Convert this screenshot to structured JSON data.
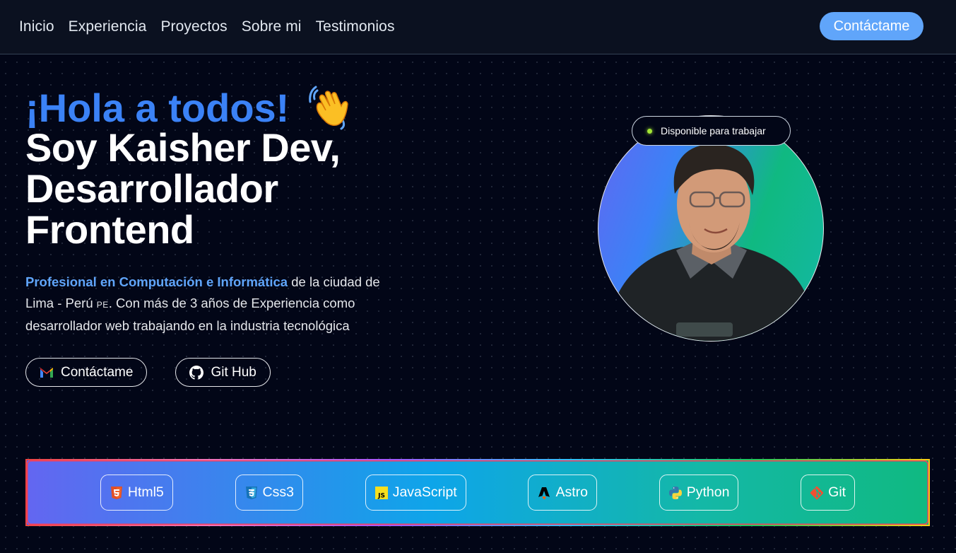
{
  "nav": {
    "links": [
      "Inicio",
      "Experiencia",
      "Proyectos",
      "Sobre mi",
      "Testimonios"
    ],
    "cta_label": "Contáctame"
  },
  "hero": {
    "greeting": "¡Hola a todos!",
    "headline_line1": "Soy Kaisher Dev,",
    "headline_line2": "Desarrollador",
    "headline_line3": "Frontend",
    "bio_highlight": "Profesional en Computación e Informática",
    "bio_part1": " de la ciudad de Lima - Perú ",
    "bio_flag": "PE",
    "bio_part2": ". Con más de 3 años de Experiencia como desarrollador web trabajando en la industria tecnológica",
    "contact_button": "Contáctame",
    "github_button": "Git Hub"
  },
  "avatar": {
    "status_text": "Disponible para trabajar",
    "status_color": "#a3e635"
  },
  "skills": [
    {
      "label": "Html5",
      "icon": "html5-icon",
      "color": "#e34f26"
    },
    {
      "label": "Css3",
      "icon": "css3-icon",
      "color": "#1572b6"
    },
    {
      "label": "JavaScript",
      "icon": "javascript-icon",
      "color": "#f7df1e"
    },
    {
      "label": "Astro",
      "icon": "astro-icon",
      "color": "#000000"
    },
    {
      "label": "Python",
      "icon": "python-icon",
      "color": "#3776ab"
    },
    {
      "label": "Git",
      "icon": "git-icon",
      "color": "#f05032"
    }
  ],
  "colors": {
    "accent": "#3b82f6",
    "background": "#020617",
    "nav_background": "#0b1120"
  }
}
